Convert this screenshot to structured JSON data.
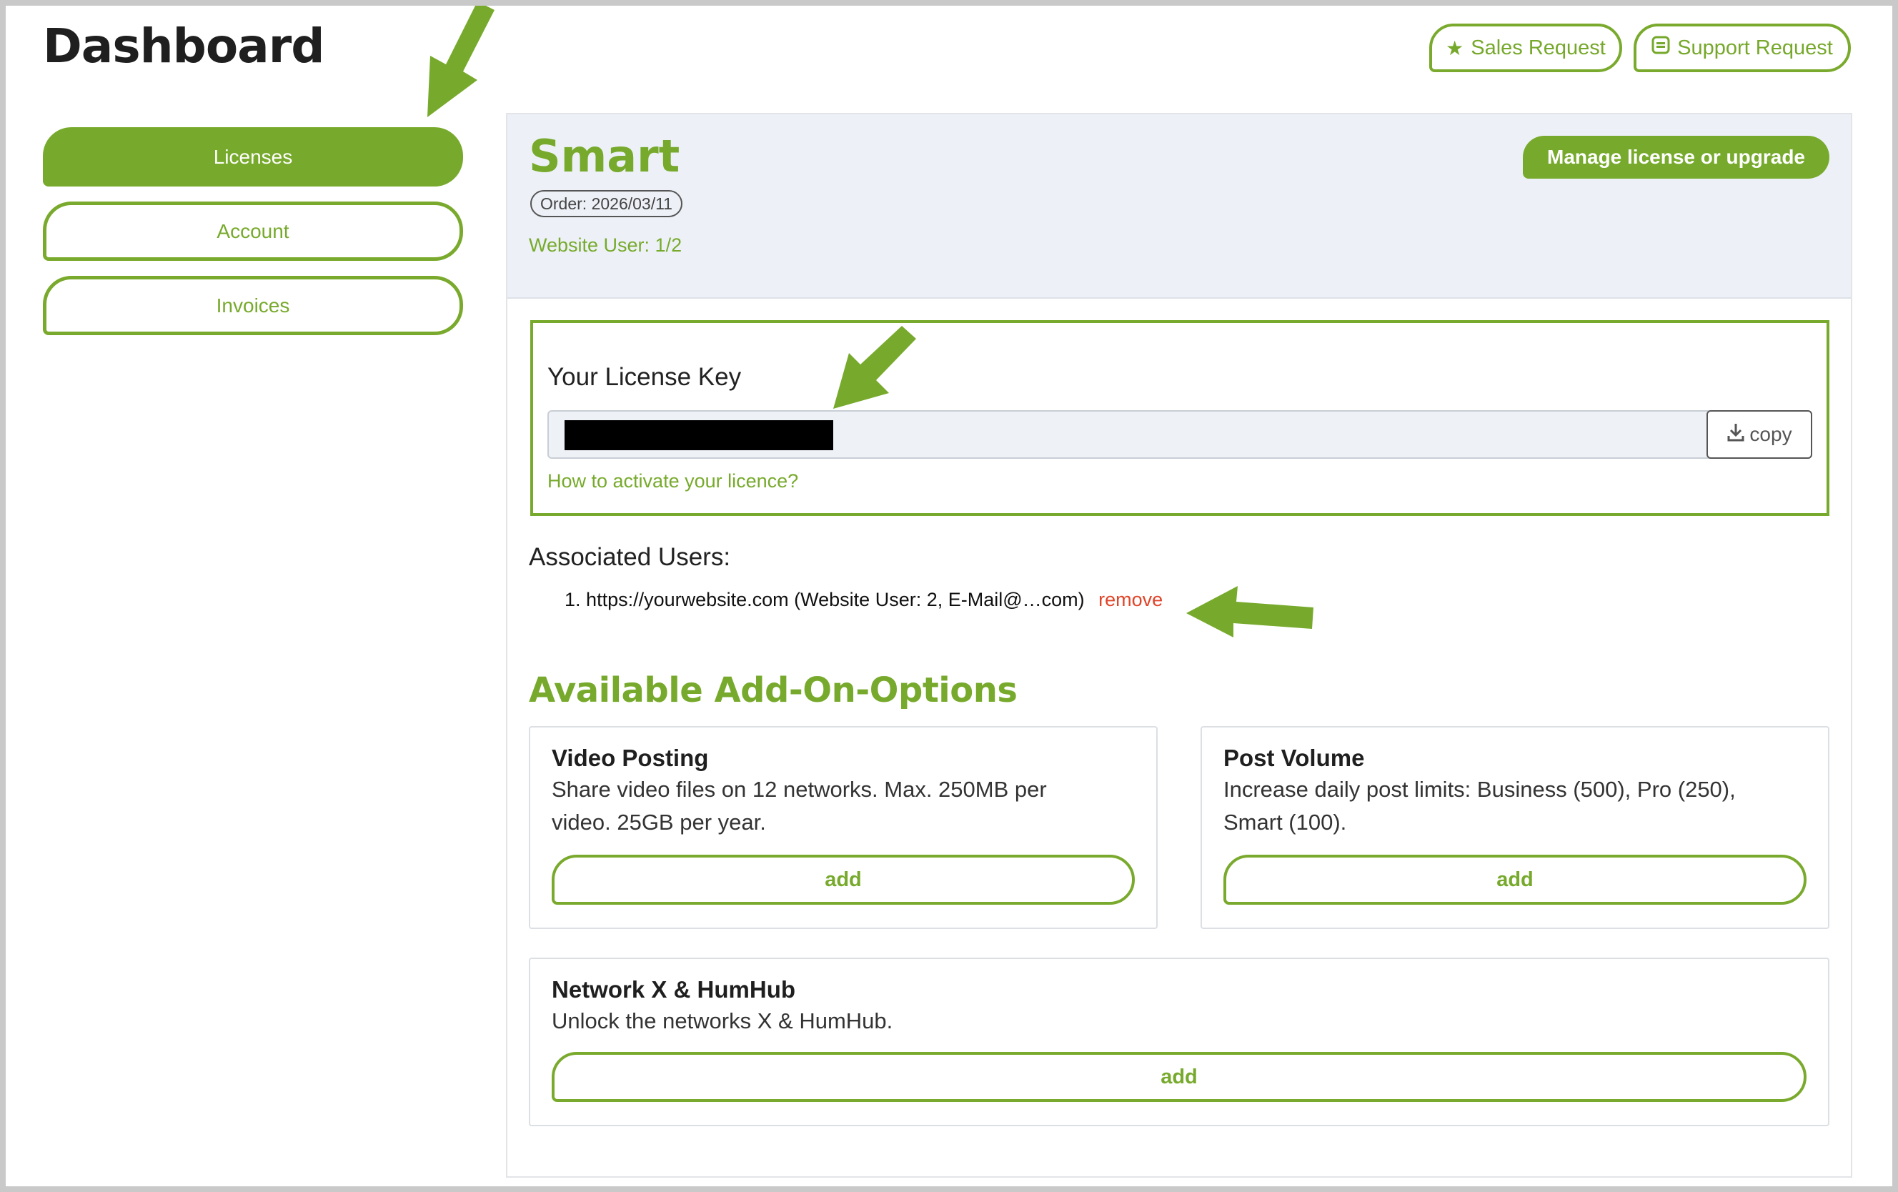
{
  "page": {
    "title": "Dashboard"
  },
  "header": {
    "sales": {
      "label": "Sales Request",
      "icon": "star-icon"
    },
    "support": {
      "label": "Support Request",
      "icon": "chat-icon"
    }
  },
  "sidebar": {
    "items": [
      {
        "label": "Licenses",
        "active": true
      },
      {
        "label": "Account",
        "active": false
      },
      {
        "label": "Invoices",
        "active": false
      }
    ]
  },
  "license": {
    "plan": "Smart",
    "order": "Order: 2026/03/11",
    "website_user": "Website User: 1/2",
    "manage_label": "Manage license or upgrade",
    "key_label": "Your License Key",
    "copy_label": "copy",
    "howto_label": "How to activate your licence?"
  },
  "associated": {
    "title": "Associated Users:",
    "items": [
      {
        "number": "1.",
        "text": "https://yourwebsite.com (Website User: 2, E-Mail@…com)",
        "remove_label": "remove"
      }
    ]
  },
  "addons": {
    "title": "Available Add-On-Options",
    "items": [
      {
        "title": "Video Posting",
        "desc_line1": "Share video files on 12 networks. Max. 250MB per",
        "desc_line2": "video. 25GB per year.",
        "button": "add"
      },
      {
        "title": "Post Volume",
        "desc_line1": "Increase daily post limits: Business (500), Pro (250),",
        "desc_line2": "Smart (100).",
        "button": "add"
      },
      {
        "title": "Network X & HumHub",
        "desc_line1": "Unlock the networks X & HumHub.",
        "button": "add"
      }
    ]
  },
  "colors": {
    "accent": "#77aa2c",
    "remove": "#e0452a",
    "header_bg": "#edf1f7"
  }
}
